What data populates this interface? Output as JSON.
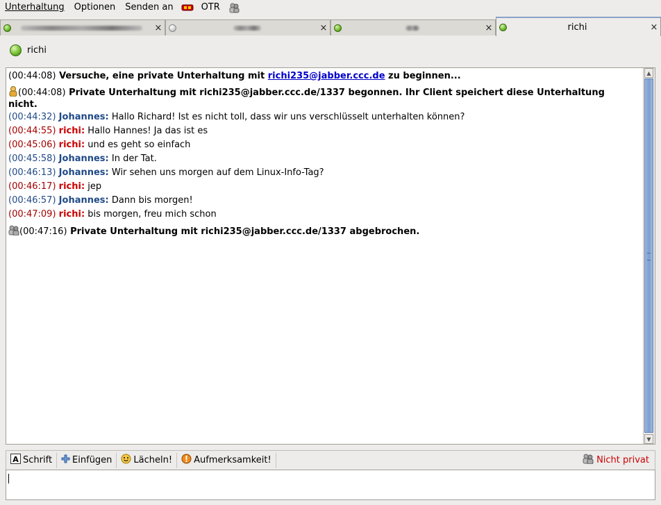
{
  "menu": {
    "items": [
      {
        "label": "Unterhaltung"
      },
      {
        "label": "Optionen"
      },
      {
        "label": "Senden an"
      }
    ],
    "otr_label": "OTR"
  },
  "tabs": [
    {
      "label": "",
      "status": "online",
      "close": "×"
    },
    {
      "label": "",
      "status": "offline",
      "close": "×"
    },
    {
      "label": "",
      "status": "online",
      "close": "×"
    },
    {
      "label": "richi",
      "status": "online",
      "close": "×",
      "active": true
    }
  ],
  "contact": {
    "name": "richi"
  },
  "messages": [
    {
      "type": "system",
      "time": "(00:44:08)",
      "text_before": "Versuche, eine private Unterhaltung mit ",
      "link": "richi235@jabber.ccc.de",
      "text_after": " zu beginnen..."
    },
    {
      "type": "system-icon",
      "icon": "otr-private-icon",
      "time": "(00:44:08)",
      "text": "Private Unterhaltung mit richi235@jabber.ccc.de/1337 begonnen.  Ihr Client speichert diese Unterhaltung nicht."
    },
    {
      "type": "msg",
      "sender": "johannes",
      "time": "(00:44:32)",
      "nick": "Johannes:",
      "text": "Hallo Richard! Ist es nicht toll, dass wir uns verschlüsselt unterhalten können?"
    },
    {
      "type": "msg",
      "sender": "richi",
      "time": "(00:44:55)",
      "nick": "richi:",
      "text": "Hallo Hannes! Ja das ist es"
    },
    {
      "type": "msg",
      "sender": "richi",
      "time": "(00:45:06)",
      "nick": "richi:",
      "text": "und es geht so einfach"
    },
    {
      "type": "msg",
      "sender": "johannes",
      "time": "(00:45:58)",
      "nick": "Johannes:",
      "text": "In der Tat."
    },
    {
      "type": "msg",
      "sender": "johannes",
      "time": "(00:46:13)",
      "nick": "Johannes:",
      "text": "Wir sehen uns morgen auf dem Linux-Info-Tag?"
    },
    {
      "type": "msg",
      "sender": "richi",
      "time": "(00:46:17)",
      "nick": "richi:",
      "text": "jep"
    },
    {
      "type": "msg",
      "sender": "johannes",
      "time": "(00:46:57)",
      "nick": "Johannes:",
      "text": "Dann bis morgen!"
    },
    {
      "type": "msg",
      "sender": "richi",
      "time": "(00:47:09)",
      "nick": "richi:",
      "text": "bis morgen, freu mich schon"
    },
    {
      "type": "system-icon",
      "icon": "otr-not-private-icon",
      "time": "(00:47:16)",
      "text": "Private Unterhaltung mit richi235@jabber.ccc.de/1337 abgebrochen."
    }
  ],
  "toolbar": {
    "font_label": "Schrift",
    "insert_label": "Einfügen",
    "smile_label": "Lächeln!",
    "attention_label": "Aufmerksamkeit!",
    "privacy_status": "Nicht privat"
  },
  "colors": {
    "johannes": "#204a87",
    "richi": "#cc0000",
    "link": "#0000cc",
    "not_private": "#cc0000"
  }
}
